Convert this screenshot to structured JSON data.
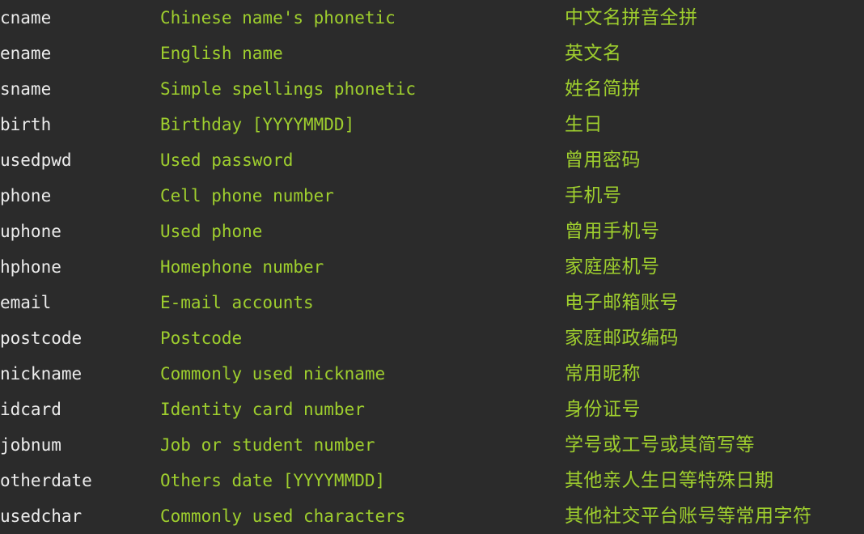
{
  "theme": {
    "background": "#2b2b2b",
    "key_color": "#ececec",
    "value_color": "#9fcf2e"
  },
  "table": {
    "columns": [
      {
        "name": "field-key",
        "label": ""
      },
      {
        "name": "field-description-en",
        "label": ""
      },
      {
        "name": "field-description-zh",
        "label": ""
      }
    ],
    "rows": [
      {
        "key": "cname",
        "en": "Chinese name's phonetic",
        "zh": "中文名拼音全拼"
      },
      {
        "key": "ename",
        "en": "English name",
        "zh": "英文名"
      },
      {
        "key": "sname",
        "en": "Simple spellings phonetic",
        "zh": "姓名简拼"
      },
      {
        "key": "birth",
        "en": "Birthday [YYYYMMDD]",
        "zh": "生日"
      },
      {
        "key": "usedpwd",
        "en": "Used password",
        "zh": "曾用密码"
      },
      {
        "key": "phone",
        "en": "Cell phone number",
        "zh": "手机号"
      },
      {
        "key": "uphone",
        "en": "Used phone",
        "zh": "曾用手机号"
      },
      {
        "key": "hphone",
        "en": "Homephone number",
        "zh": "家庭座机号"
      },
      {
        "key": "email",
        "en": "E-mail accounts",
        "zh": "电子邮箱账号"
      },
      {
        "key": "postcode",
        "en": "Postcode",
        "zh": "家庭邮政编码"
      },
      {
        "key": "nickname",
        "en": "Commonly used nickname",
        "zh": "常用昵称"
      },
      {
        "key": "idcard",
        "en": "Identity card number",
        "zh": "身份证号"
      },
      {
        "key": "jobnum",
        "en": "Job or student number",
        "zh": "学号或工号或其简写等"
      },
      {
        "key": "otherdate",
        "en": "Others date [YYYYMMDD]",
        "zh": "其他亲人生日等特殊日期"
      },
      {
        "key": "usedchar",
        "en": "Commonly used characters",
        "zh": "其他社交平台账号等常用字符"
      }
    ]
  }
}
